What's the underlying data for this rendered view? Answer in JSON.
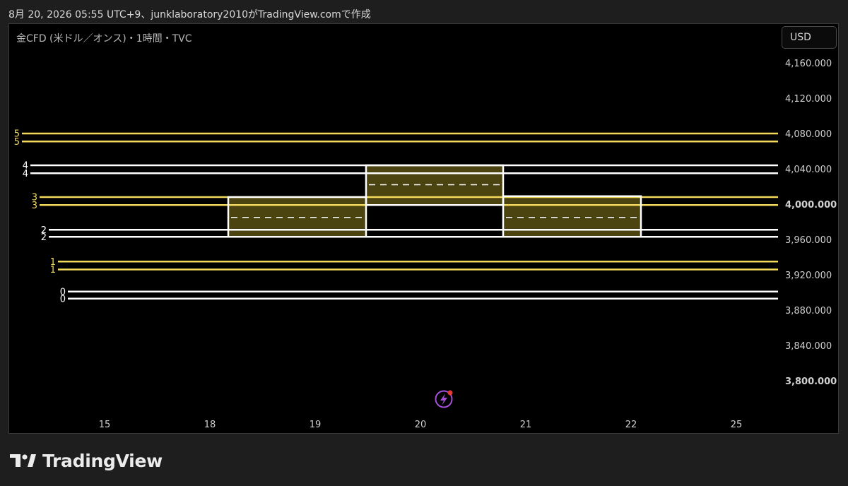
{
  "caption": "8月 20, 2026 05:55 UTC+9、junklaboratory2010がTradingView.comで作成",
  "chart_header": {
    "symbol_line": "金CFD (米ドル／オンス)・1時間・TVC",
    "currency_button": "USD"
  },
  "footer": {
    "brand": "TradingView"
  },
  "colors": {
    "yellow": "#f2d95c",
    "white": "#ffffff",
    "box_fill": "#4b4310",
    "axis_text": "#d0d0d0",
    "alert_icon": "#a34fd8",
    "alert_dot": "#e53935"
  },
  "chart_data": {
    "type": "line",
    "title": "",
    "xlabel": "",
    "ylabel": "",
    "x_ticks": [
      "15",
      "18",
      "19",
      "20",
      "21",
      "22",
      "25"
    ],
    "y_ticks": [
      "4,160.000",
      "4,120.000",
      "4,080.000",
      "4,040.000",
      "4,000.000",
      "3,960.000",
      "3,920.000",
      "3,880.000",
      "3,840.000",
      "3,800.000"
    ],
    "ylim": [
      3800,
      4160
    ],
    "grid": false,
    "horizontal_levels": [
      {
        "label": "5",
        "values": [
          4080,
          4071
        ],
        "color": "yellow"
      },
      {
        "label": "4",
        "values": [
          4044,
          4035
        ],
        "color": "white"
      },
      {
        "label": "3",
        "values": [
          4008,
          3999
        ],
        "color": "yellow"
      },
      {
        "label": "2",
        "values": [
          3971,
          3963
        ],
        "color": "white"
      },
      {
        "label": "1",
        "values": [
          3935,
          3926
        ],
        "color": "yellow"
      },
      {
        "label": "0",
        "values": [
          3901,
          3893
        ],
        "color": "white"
      }
    ],
    "boxes": [
      {
        "start": "18",
        "end": "19",
        "high": 4008,
        "low": 3963,
        "mid": 3985
      },
      {
        "start": "19",
        "end": "20",
        "high": 4044,
        "low": 3999,
        "mid": 4022
      },
      {
        "start": "20",
        "end": "21",
        "high": 4009,
        "low": 3963,
        "mid": 3985
      }
    ]
  }
}
